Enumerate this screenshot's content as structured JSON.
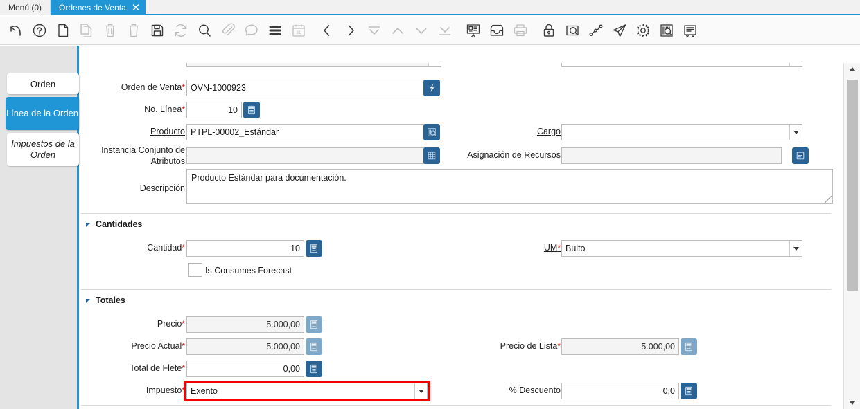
{
  "window": {
    "tabs": [
      {
        "label": "Menú (0)",
        "active": false,
        "closable": false
      },
      {
        "label": "Órdenes de Venta",
        "active": true,
        "closable": true,
        "close_icon": "close-icon"
      }
    ]
  },
  "toolbar": {
    "buttons": [
      {
        "name": "undo-icon",
        "title": "Deshacer",
        "enabled": true
      },
      {
        "name": "help-icon",
        "title": "Ayuda",
        "enabled": true
      },
      {
        "name": "new-record-icon",
        "title": "Nuevo Registro",
        "enabled": true
      },
      {
        "name": "copy-record-icon",
        "title": "Copiar Registro",
        "enabled": false
      },
      {
        "name": "delete-icon",
        "title": "Eliminar",
        "enabled": false
      },
      {
        "name": "delete-all-icon",
        "title": "Eliminar Todo",
        "enabled": false
      },
      {
        "name": "save-icon",
        "title": "Guardar",
        "enabled": true
      },
      {
        "name": "refresh-icon",
        "title": "Refrescar",
        "enabled": false
      },
      {
        "name": "find-icon",
        "title": "Buscar",
        "enabled": true
      },
      {
        "name": "attachment-icon",
        "title": "Adjunto",
        "enabled": false
      },
      {
        "name": "chat-icon",
        "title": "Nota",
        "enabled": false
      },
      {
        "name": "grid-toggle-icon",
        "title": "Cambiar Vista",
        "enabled": true
      },
      {
        "name": "calendar-icon",
        "title": "Calendario",
        "enabled": false
      },
      {
        "name": "prev-record-icon",
        "title": "Registro Anterior",
        "enabled": true
      },
      {
        "name": "next-record-icon",
        "title": "Registro Siguiente",
        "enabled": true
      },
      {
        "name": "first-record-icon",
        "title": "Primer Registro",
        "enabled": false
      },
      {
        "name": "up-record-icon",
        "title": "Arriba",
        "enabled": false
      },
      {
        "name": "down-record-icon",
        "title": "Abajo",
        "enabled": false
      },
      {
        "name": "last-record-icon",
        "title": "Último Registro",
        "enabled": false
      },
      {
        "name": "report-icon",
        "title": "Reporte",
        "enabled": true
      },
      {
        "name": "archive-icon",
        "title": "Archivo",
        "enabled": true
      },
      {
        "name": "print-icon",
        "title": "Imprimir",
        "enabled": false
      },
      {
        "name": "lock-icon",
        "title": "Bloquear Registro",
        "enabled": true
      },
      {
        "name": "zoom-across-icon",
        "title": "Zoom",
        "enabled": true
      },
      {
        "name": "workflow-icon",
        "title": "Flujo de Trabajo",
        "enabled": true
      },
      {
        "name": "send-icon",
        "title": "Enviar",
        "enabled": true
      },
      {
        "name": "settings-icon",
        "title": "Preferencias",
        "enabled": true
      },
      {
        "name": "product-info-icon",
        "title": "Info Producto",
        "enabled": true
      },
      {
        "name": "ledger-icon",
        "title": "Documento",
        "enabled": true
      }
    ]
  },
  "side_tabs": [
    {
      "label": "Orden",
      "selected": false,
      "italic": false
    },
    {
      "label": "Línea de la Orden",
      "selected": true,
      "italic": false
    },
    {
      "label": "Impuestos de la Orden",
      "selected": false,
      "italic": true
    }
  ],
  "form": {
    "fields": {
      "orden_de_venta": {
        "label": "Orden de Venta",
        "required": true,
        "value": "OVN-1000923",
        "button_icon": "bolt-icon"
      },
      "no_linea": {
        "label": "No. Línea",
        "required": true,
        "value": "10",
        "button_icon": "calculator-icon"
      },
      "producto": {
        "label": "Producto",
        "required": false,
        "value": "PTPL-00002_Estándar",
        "button_icon": "product-lookup-icon"
      },
      "cargo": {
        "label": "Cargo",
        "required": false,
        "value": "",
        "control": "dropdown"
      },
      "instancia_conjunto_atributos": {
        "label": "Instancia Conjunto de Atributos",
        "required": false,
        "value": "",
        "button_icon": "attribute-set-icon"
      },
      "asignacion_recursos": {
        "label": "Asignación de Recursos",
        "required": false,
        "value": "",
        "button_icon": "resource-assign-icon"
      },
      "descripcion": {
        "label": "Descripción",
        "required": false,
        "value": "Producto Estándar para documentación."
      },
      "cantidad": {
        "label": "Cantidad",
        "required": true,
        "value": "10",
        "button_icon": "calculator-icon"
      },
      "um": {
        "label": "UM",
        "required": true,
        "value": "Bulto",
        "control": "dropdown"
      },
      "is_consumes_forecast": {
        "label": "Is Consumes Forecast",
        "checked": false
      },
      "precio": {
        "label": "Precio",
        "required": true,
        "value": "5.000,00",
        "readonly": true,
        "button_icon": "calculator-icon"
      },
      "precio_actual": {
        "label": "Precio Actual",
        "required": true,
        "value": "5.000,00",
        "readonly": true,
        "button_icon": "calculator-icon"
      },
      "precio_de_lista": {
        "label": "Precio de Lista",
        "required": true,
        "value": "5.000,00",
        "readonly": true,
        "button_icon": "calculator-icon"
      },
      "total_de_flete": {
        "label": "Total de Flete",
        "required": true,
        "value": "0,00",
        "readonly": false,
        "button_icon": "calculator-icon"
      },
      "impuesto": {
        "label": "Impuesto",
        "required": true,
        "value": "Exento",
        "control": "dropdown",
        "highlighted": true
      },
      "porcentaje_descuento": {
        "label": "% Descuento",
        "required": false,
        "value": "0,0",
        "button_icon": "calculator-icon"
      }
    },
    "sections": [
      {
        "key": "cantidades",
        "label": "Cantidades",
        "collapsed": false
      },
      {
        "key": "totales",
        "label": "Totales",
        "collapsed": false
      }
    ]
  },
  "colors": {
    "accent": "#2196d6",
    "field_button": "#2a6496",
    "field_button_disabled": "#7fa7c7",
    "highlight": "#f20000",
    "required_marker": "#e00000",
    "side_panel": "#e4e4e4"
  }
}
